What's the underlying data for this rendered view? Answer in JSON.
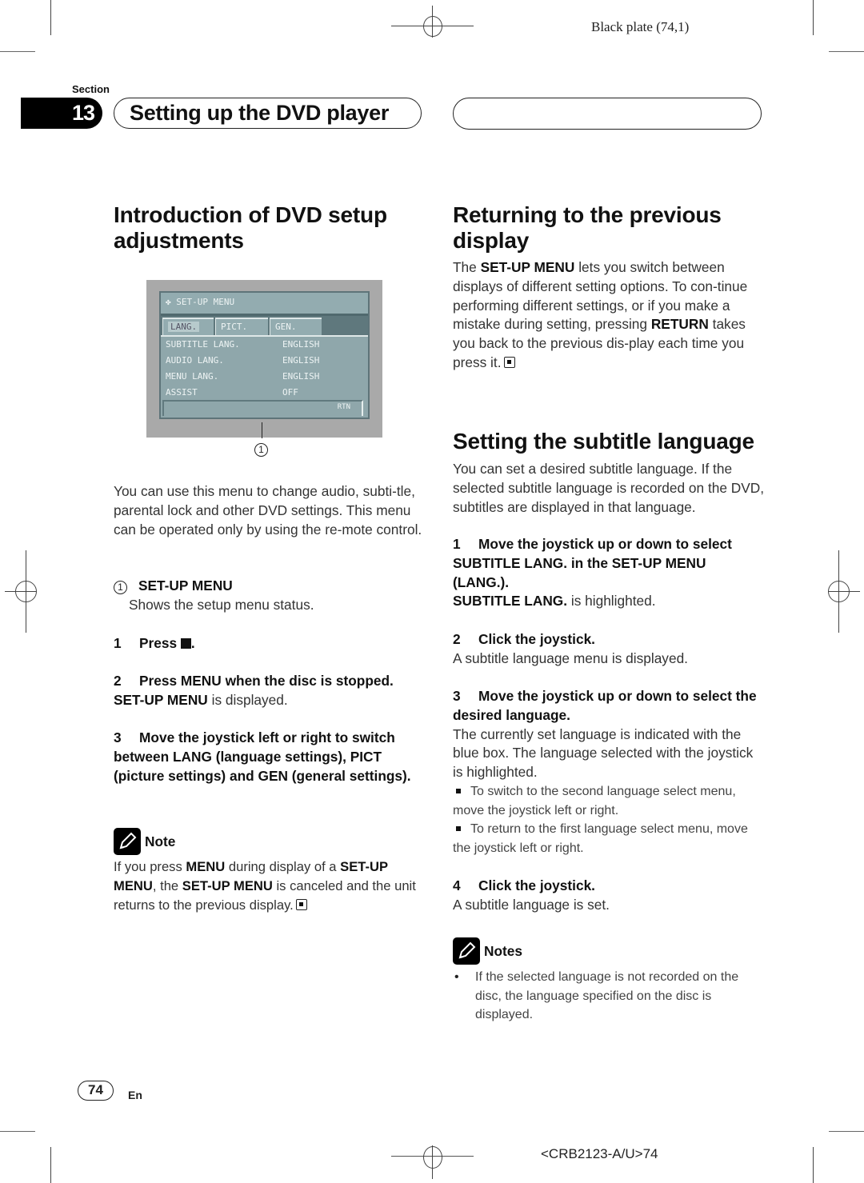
{
  "print_marks": {
    "plate_label": "Black plate (74,1)",
    "footer_code": "<CRB2123-A/U>74"
  },
  "section": {
    "label": "Section",
    "number": "13",
    "title": "Setting up the DVD player"
  },
  "left_column": {
    "heading": "Introduction of DVD setup adjustments",
    "figure": {
      "screen_title": "SET-UP MENU",
      "tabs": [
        {
          "label": "LANG.",
          "active": true
        },
        {
          "label": "PICT.",
          "active": false
        },
        {
          "label": "GEN.",
          "active": false
        }
      ],
      "rows": [
        {
          "label": "SUBTITLE LANG.",
          "value": "ENGLISH"
        },
        {
          "label": "AUDIO LANG.",
          "value": "ENGLISH"
        },
        {
          "label": "MENU LANG.",
          "value": "ENGLISH"
        },
        {
          "label": "ASSIST",
          "value": "OFF"
        }
      ],
      "return_label": "RTN",
      "callout_number": "1",
      "colors": {
        "screen_bg": "#8fa7ab",
        "frame_bg": "#a9a9a9",
        "tab_bar": "#5f787d"
      }
    },
    "intro_paragraph": "You can use this menu to change audio, subti-tle, parental lock and other DVD settings. This menu can be operated only by using the re-mote control.",
    "callout_item": {
      "number": "1",
      "term": "SET-UP MENU",
      "description": "Shows the setup menu status."
    },
    "steps": [
      {
        "num": "1",
        "text": "Press",
        "glyph": "stop-square",
        "suffix": "."
      },
      {
        "num": "2",
        "text": "Press MENU when the disc is stopped.",
        "result_bold": "SET-UP MENU",
        "result_rest": " is displayed."
      },
      {
        "num": "3",
        "text": "Move the joystick left or right to switch between LANG (language settings), PICT (picture settings) and GEN (general settings)."
      }
    ],
    "note": {
      "title": "Note",
      "parts": {
        "p1": "If you press ",
        "b1": "MENU",
        "p2": " during display of a ",
        "b2": "SET-UP MENU",
        "p3": ", the ",
        "b3": "SET-UP MENU",
        "p4": " is canceled and the unit returns to the previous display."
      }
    }
  },
  "right_column": {
    "return_section": {
      "heading": "Returning to the previous display",
      "parts": {
        "p1": "The ",
        "b1": "SET-UP MENU",
        "p2": " lets you switch between displays of different setting options. To con-tinue performing different settings, or if you make a mistake during setting, pressing ",
        "b2": "RETURN",
        "p3": " takes you back to the previous dis-play each time you press it."
      }
    },
    "subtitle_section": {
      "heading": "Setting the subtitle language",
      "intro": "You can set a desired subtitle language. If the selected subtitle language is recorded on the DVD, subtitles are displayed in that language.",
      "steps": [
        {
          "num": "1",
          "text": "Move the joystick up or down to select SUBTITLE LANG. in the SET-UP MENU (LANG.).",
          "result_bold": "SUBTITLE LANG.",
          "result_rest": " is highlighted."
        },
        {
          "num": "2",
          "text": "Click the joystick.",
          "result": "A subtitle language menu is displayed."
        },
        {
          "num": "3",
          "text": "Move the joystick up or down to select the desired language.",
          "result": "The currently set language is indicated with the blue box. The language selected with the joystick is highlighted.",
          "bullets": [
            "To switch to the second language select menu, move the joystick left or right.",
            "To return to the first language select menu, move the joystick left or right."
          ]
        },
        {
          "num": "4",
          "text": "Click the joystick.",
          "result": "A subtitle language is set."
        }
      ],
      "notes": {
        "title": "Notes",
        "items": [
          "If the selected language is not recorded on the disc, the language specified on the disc is displayed."
        ]
      }
    }
  },
  "footer": {
    "page_number": "74",
    "language": "En"
  }
}
